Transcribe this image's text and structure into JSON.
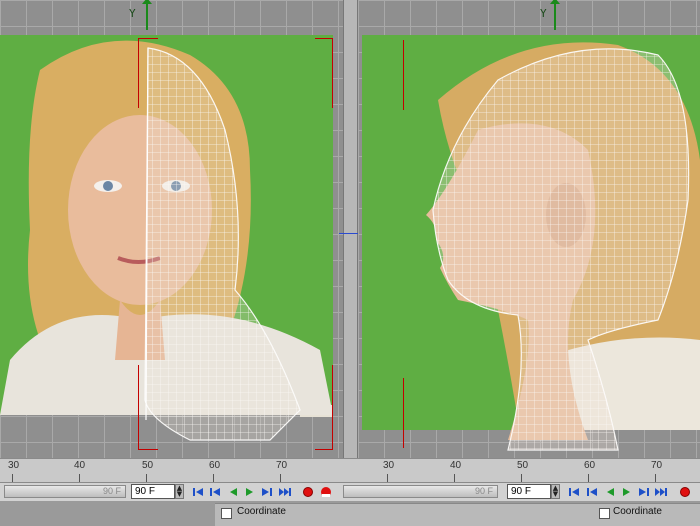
{
  "viewports": {
    "left": {
      "axis_label": "Y",
      "view": "front"
    },
    "right": {
      "axis_label": "Y",
      "view": "side"
    }
  },
  "timeline_left": {
    "ticks": [
      "30",
      "40",
      "50",
      "60",
      "70"
    ]
  },
  "timeline_right": {
    "ticks": [
      "30",
      "40",
      "50",
      "60",
      "70"
    ]
  },
  "controls_left": {
    "slider_value": "90 F",
    "frame_value": "90 F"
  },
  "controls_right": {
    "slider_value": "90 F",
    "frame_value": "90 F"
  },
  "attributes_left": {
    "label": "Coordinate"
  },
  "attributes_right": {
    "label": "Coordinate"
  },
  "icons": [
    "first-frame-icon",
    "prev-key-icon",
    "prev-frame-icon",
    "play-icon",
    "next-frame-icon",
    "next-key-icon",
    "last-frame-icon",
    "record-icon",
    "autokey-icon"
  ],
  "colors": {
    "greenscreen": "#5fae43",
    "frame_marker": "#c40000",
    "axis": "#1a8a1a"
  }
}
